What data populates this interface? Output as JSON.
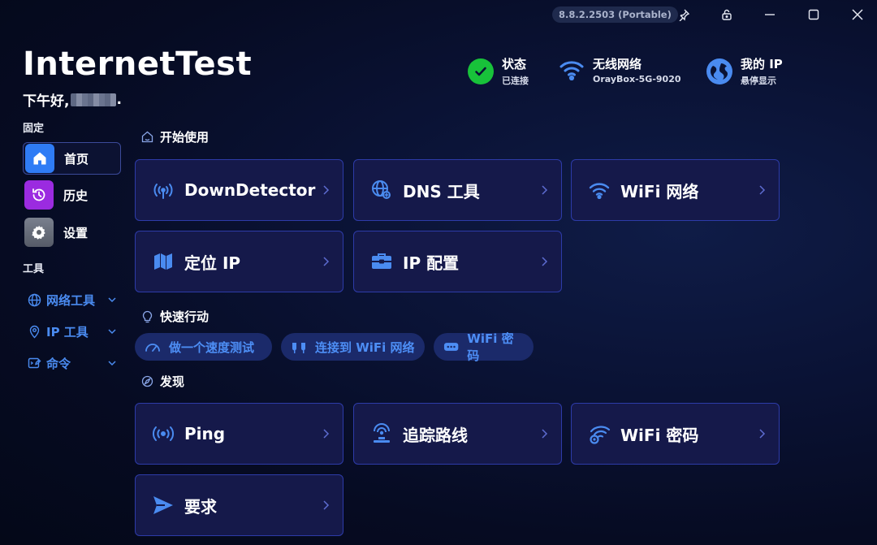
{
  "window": {
    "version": "8.8.2.2503 (Portable)",
    "controls": [
      "pin-icon",
      "lock-icon",
      "minimize-icon",
      "maximize-icon",
      "close-icon"
    ]
  },
  "header": {
    "title": "InternetTest",
    "greeting_prefix": "下午好,",
    "greeting_suffix": "."
  },
  "status": {
    "connection": {
      "title": "状态",
      "sub": "已连接",
      "icon": "check-icon",
      "color": "#18c23a"
    },
    "wifi": {
      "title": "无线网络",
      "sub": "OrayBox-5G-9020",
      "icon": "wifi-icon"
    },
    "ip": {
      "title": "我的 IP",
      "sub": "悬停显示",
      "icon": "globe-icon"
    }
  },
  "sidebar": {
    "pinned_heading": "固定",
    "pinned": [
      {
        "label": "首页",
        "icon": "home-icon",
        "color": "#2f7cf5",
        "active": true
      },
      {
        "label": "历史",
        "icon": "history-icon",
        "color": "#9b2be0",
        "active": false
      },
      {
        "label": "设置",
        "icon": "gear-icon",
        "color": "#6f7480",
        "active": false
      }
    ],
    "tools_heading": "工具",
    "tools": [
      {
        "label": "网络工具",
        "icon": "globe-icon"
      },
      {
        "label": "IP 工具",
        "icon": "location-pin-icon"
      },
      {
        "label": "命令",
        "icon": "command-icon"
      }
    ]
  },
  "sections": {
    "get_started": "开始使用",
    "quick_actions": "快速行动",
    "discover": "发现"
  },
  "get_started_cards": [
    {
      "label": "DownDetector",
      "icon": "radar-icon"
    },
    {
      "label": "DNS 工具",
      "icon": "dns-globe-icon"
    },
    {
      "label": "WiFi 网络",
      "icon": "wifi-icon"
    },
    {
      "label": "定位 IP",
      "icon": "map-icon"
    },
    {
      "label": "IP 配置",
      "icon": "toolbox-icon"
    }
  ],
  "quick_actions": [
    {
      "label": "做一个速度测试",
      "icon": "speedometer-icon"
    },
    {
      "label": "连接到 WiFi 网络",
      "icon": "connect-plug-icon"
    },
    {
      "label": "WiFi 密码",
      "icon": "password-icon"
    }
  ],
  "discover_cards": [
    {
      "label": "Ping",
      "icon": "ping-icon"
    },
    {
      "label": "追踪路线",
      "icon": "trace-route-icon"
    },
    {
      "label": "WiFi 密码",
      "icon": "wifi-key-icon"
    },
    {
      "label": "要求",
      "icon": "send-icon"
    }
  ],
  "colors": {
    "accent": "#4a8bf0",
    "card_bg": "#15194a",
    "card_border": "#2d3ba8",
    "pill_bg": "#1b2a6a"
  }
}
